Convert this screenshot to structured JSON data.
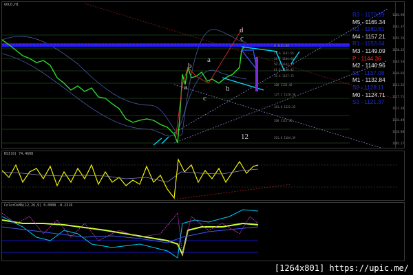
{
  "main": {
    "title": "GOLD,H1",
    "price_ticks": [
      "1166.98",
      "1161.37",
      "1155.76",
      "1150.15",
      "1144.54",
      "1138.93",
      "1133.32",
      "1127.71",
      "1122.10",
      "1116.49",
      "1110.88",
      "1105.27"
    ],
    "levels": [
      {
        "label": "R3 - 1173.59",
        "color": "#1c2bd6"
      },
      {
        "label": "M5 - 1165.34",
        "color": "#e6e6e6"
      },
      {
        "label": "R2 - 1160.61",
        "color": "#1c2bd6"
      },
      {
        "label": "M4 - 1157.21",
        "color": "#e6e6e6"
      },
      {
        "label": "R1 - 1153.64",
        "color": "#1c2bd6"
      },
      {
        "label": "M3 - 1149.09",
        "color": "#e6e6e6"
      },
      {
        "label": "P - 1144.36",
        "color": "#ff2a2a"
      },
      {
        "label": "M2 - 1140.96",
        "color": "#e6e6e6"
      },
      {
        "label": "S1 - 1137.08",
        "color": "#1c2bd6"
      },
      {
        "label": "M1 - 1132.84",
        "color": "#e6e6e6"
      },
      {
        "label": "S2 - 1128.11",
        "color": "#1c2bd6"
      },
      {
        "label": "M0 - 1124.71",
        "color": "#e6e6e6"
      },
      {
        "label": "S3 - 1121.37",
        "color": "#1c2bd6"
      }
    ],
    "wave_labels": [
      {
        "text": "d",
        "color": "#ff3c1e"
      },
      {
        "text": "c",
        "color": "#e8e8e8"
      },
      {
        "text": "a",
        "color": "#ff3c1e"
      },
      {
        "text": "b",
        "color": "#ff3c1e"
      },
      {
        "text": "c",
        "color": "#ff3c1e"
      },
      {
        "text": "a",
        "color": "#5fd0ff"
      },
      {
        "text": "b",
        "color": "#5fd0ff"
      },
      {
        "text": "12",
        "color": "#f0e24a"
      }
    ],
    "fib_labels": [
      "0  1151.08",
      "23.6  1147.95",
      "38.2  1144.68",
      "50.0  1142.55",
      "61.8  1140.42",
      "76.4  1137.72",
      "100  1133.46",
      "127.2  1128.58",
      "161.8  1122.35",
      "200  1115.46",
      "261.8  1104.39"
    ]
  },
  "rsi": {
    "title": "RSI(8) 74.4608"
  },
  "osc": {
    "title": "ColorOsMA(12,26,9) 0.0008 -0.2316"
  },
  "watermark": "[1264x801] https://upic.me/"
}
